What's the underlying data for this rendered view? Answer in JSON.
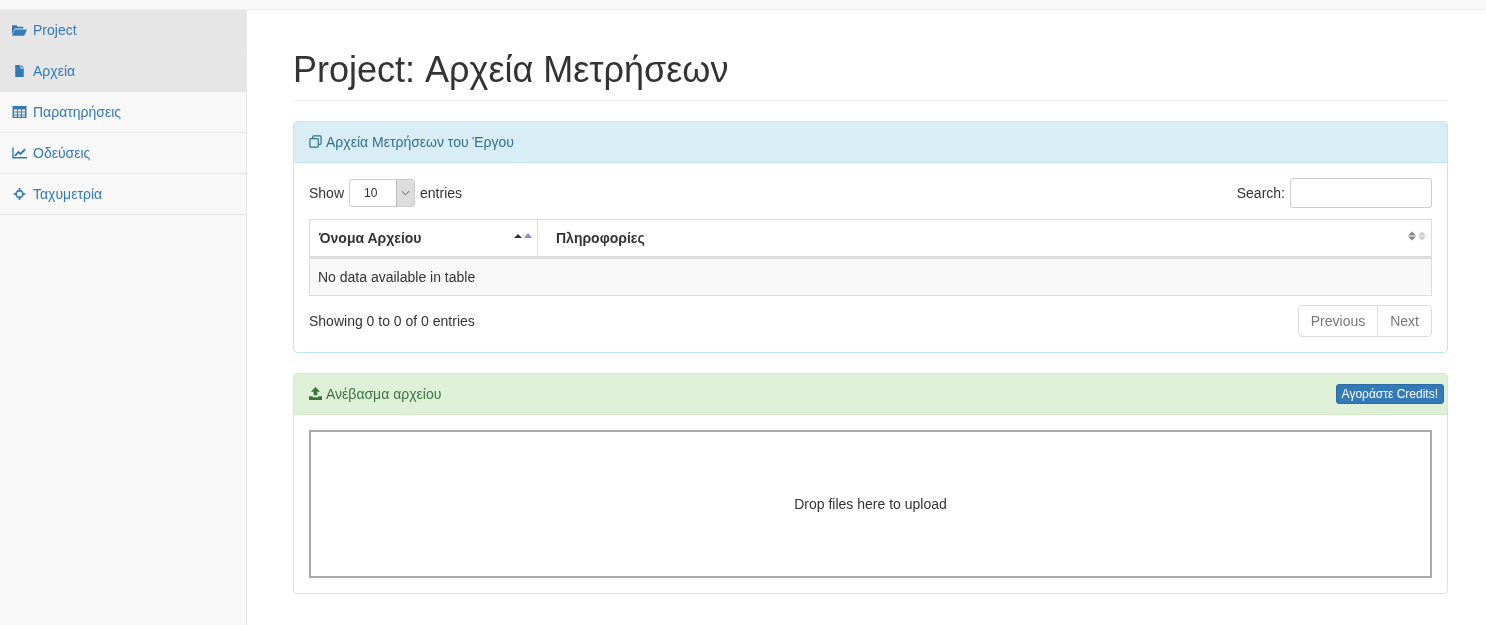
{
  "sidebar": {
    "items": [
      {
        "label": "Project",
        "selected": true
      },
      {
        "label": "Αρχεία",
        "selected": true
      },
      {
        "label": "Παρατηρήσεις",
        "selected": false
      },
      {
        "label": "Οδεύσεις",
        "selected": false
      },
      {
        "label": "Ταχυμετρία",
        "selected": false
      }
    ]
  },
  "page_title": "Project: Αρχεία Μετρήσεων",
  "files_panel": {
    "title": "Αρχεία Μετρήσεων του Έργου",
    "show_label": "Show",
    "page_size": "10",
    "entries_label": "entries",
    "search_label": "Search:",
    "table": {
      "columns": [
        {
          "label": "Όνομα Αρχείου",
          "sorted": true
        },
        {
          "label": "Πληροφορίες",
          "sorted": false
        }
      ],
      "empty_message": "No data available in table"
    },
    "info": "Showing 0 to 0 of 0 entries",
    "pagination": [
      {
        "label": "Previous",
        "disabled": true
      },
      {
        "label": "Next",
        "disabled": true
      }
    ]
  },
  "upload_panel": {
    "title": "Ανέβασμα αρχείου",
    "button": "Αγοράστε Credits!",
    "dropzone": "Drop files here to upload"
  }
}
